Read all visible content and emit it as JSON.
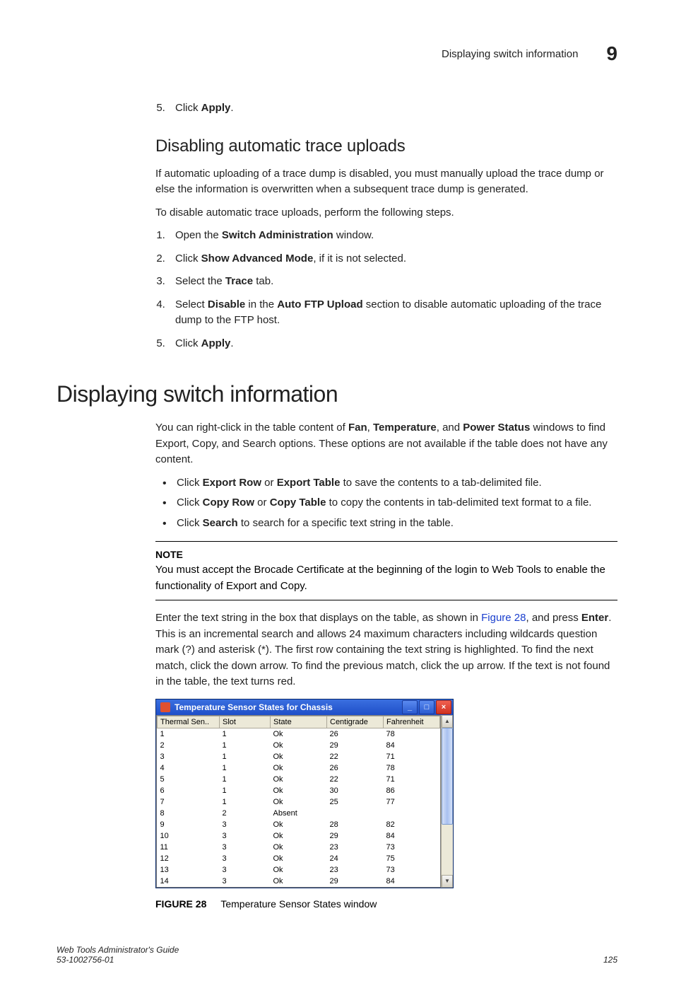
{
  "header": {
    "running_title": "Displaying switch information",
    "chapter": "9"
  },
  "step5_pre": {
    "num": "5.",
    "pre": "Click ",
    "bold": "Apply",
    "post": "."
  },
  "subsection": "Disabling automatic trace uploads",
  "para_disable_intro": "If automatic uploading of a trace dump is disabled, you must manually upload the trace dump or else the information is overwritten when a subsequent trace dump is generated.",
  "para_disable_steps_intro": "To disable automatic trace uploads, perform the following steps.",
  "steps": [
    {
      "pre": "Open the ",
      "bold": "Switch Administration",
      "post": " window."
    },
    {
      "pre": "Click ",
      "bold": "Show Advanced Mode",
      "post": ", if it is not selected."
    },
    {
      "pre": "Select the ",
      "bold": "Trace",
      "post": " tab."
    },
    {
      "pre": "Select ",
      "bold": "Disable",
      "mid": " in the ",
      "bold2": "Auto FTP Upload",
      "post": " section to disable automatic uploading of the trace dump to the FTP host."
    },
    {
      "pre": "Click ",
      "bold": "Apply",
      "post": "."
    }
  ],
  "section_title": "Displaying switch information",
  "para_rightclick_a": "You can right-click in the table content of ",
  "para_rightclick_b": "Fan",
  "para_rightclick_c": ", ",
  "para_rightclick_d": "Temperature",
  "para_rightclick_e": ", and ",
  "para_rightclick_f": "Power Status",
  "para_rightclick_g": " windows to find Export, Copy, and Search options. These options are not available if the table does not have any content.",
  "bullets": [
    {
      "pre": "Click ",
      "b1": "Export Row",
      "mid1": " or ",
      "b2": "Export Table",
      "post": " to save the contents to a tab-delimited file."
    },
    {
      "pre": "Click ",
      "b1": "Copy Row",
      "mid1": " or ",
      "b2": "Copy Table",
      "post": " to copy the contents in tab-delimited text format to a file."
    },
    {
      "pre": "Click ",
      "b1": "Search",
      "post": " to search for a specific text string in the table."
    }
  ],
  "note": {
    "label": "NOTE",
    "text": "You must accept the Brocade Certificate at the beginning of the login to Web Tools to enable the functionality of Export and Copy."
  },
  "para_search_a": "Enter the text string in the box that displays on the table, as shown in ",
  "para_search_link": "Figure 28",
  "para_search_b": ", and press ",
  "para_search_enter": "Enter",
  "para_search_c": ". This is an incremental search and allows 24 maximum characters including wildcards question mark (?) and asterisk (*). The first row containing the text string is highlighted. To find the next match, click the down arrow. To find the previous match, click the up arrow. If the text is not found in the table, the text turns red.",
  "window": {
    "title": "Temperature Sensor States for Chassis",
    "columns": [
      "Thermal Sen..",
      "Slot",
      "State",
      "Centigrade",
      "Fahrenheit"
    ],
    "rows": [
      [
        "1",
        "1",
        "Ok",
        "26",
        "78"
      ],
      [
        "2",
        "1",
        "Ok",
        "29",
        "84"
      ],
      [
        "3",
        "1",
        "Ok",
        "22",
        "71"
      ],
      [
        "4",
        "1",
        "Ok",
        "26",
        "78"
      ],
      [
        "5",
        "1",
        "Ok",
        "22",
        "71"
      ],
      [
        "6",
        "1",
        "Ok",
        "30",
        "86"
      ],
      [
        "7",
        "1",
        "Ok",
        "25",
        "77"
      ],
      [
        "8",
        "2",
        "Absent",
        "",
        ""
      ],
      [
        "9",
        "3",
        "Ok",
        "28",
        "82"
      ],
      [
        "10",
        "3",
        "Ok",
        "29",
        "84"
      ],
      [
        "11",
        "3",
        "Ok",
        "23",
        "73"
      ],
      [
        "12",
        "3",
        "Ok",
        "24",
        "75"
      ],
      [
        "13",
        "3",
        "Ok",
        "23",
        "73"
      ],
      [
        "14",
        "3",
        "Ok",
        "29",
        "84"
      ]
    ]
  },
  "figure": {
    "label": "FIGURE 28",
    "caption": "Temperature Sensor States window"
  },
  "footer": {
    "book": "Web Tools Administrator's Guide",
    "doc": "53-1002756-01",
    "page": "125"
  }
}
